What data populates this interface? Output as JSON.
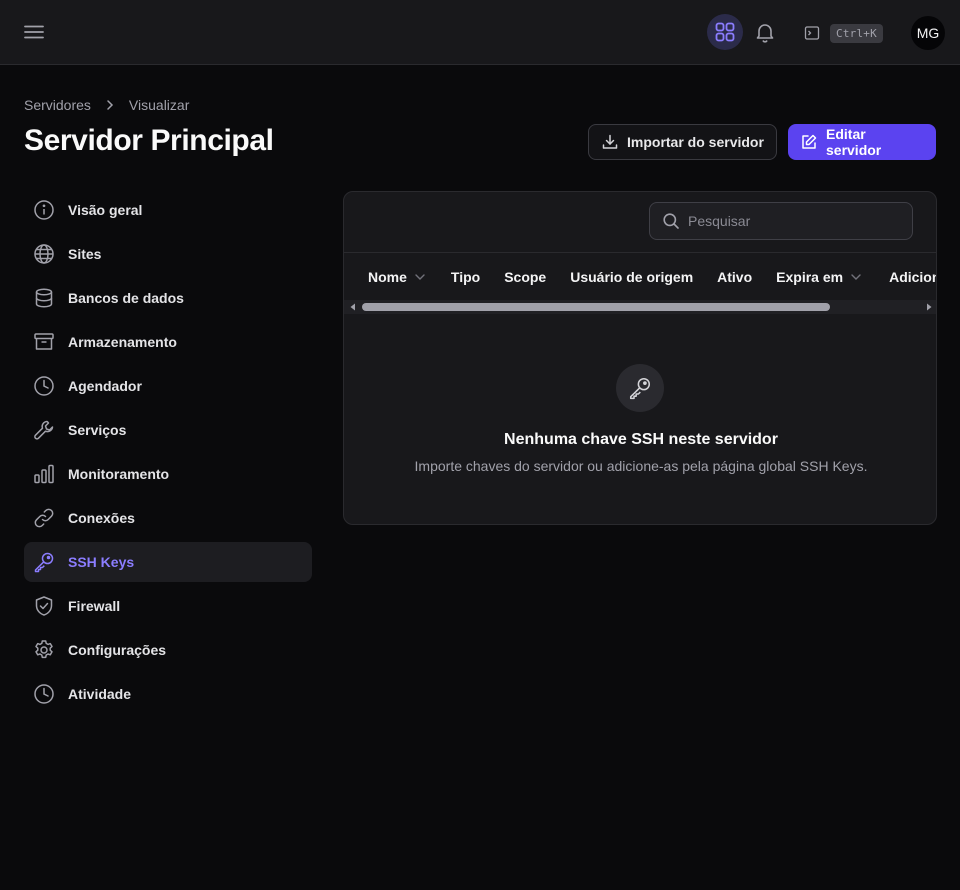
{
  "topbar": {
    "shortcut": "Ctrl+K",
    "avatar_initials": "MG"
  },
  "breadcrumb": [
    {
      "label": "Servidores"
    },
    {
      "label": "Visualizar"
    }
  ],
  "page": {
    "title": "Servidor Principal",
    "import_label": "Importar do servidor",
    "edit_label": "Editar servidor"
  },
  "sidebar": {
    "items": [
      {
        "label": "Visão geral",
        "icon": "info-icon"
      },
      {
        "label": "Sites",
        "icon": "globe-icon"
      },
      {
        "label": "Bancos de dados",
        "icon": "database-icon"
      },
      {
        "label": "Armazenamento",
        "icon": "archive-icon"
      },
      {
        "label": "Agendador",
        "icon": "clock-icon"
      },
      {
        "label": "Serviços",
        "icon": "wrench-icon"
      },
      {
        "label": "Monitoramento",
        "icon": "bar-chart-icon"
      },
      {
        "label": "Conexões",
        "icon": "link-icon"
      },
      {
        "label": "SSH Keys",
        "icon": "key-icon",
        "active": true
      },
      {
        "label": "Firewall",
        "icon": "shield-check-icon"
      },
      {
        "label": "Configurações",
        "icon": "gear-icon"
      },
      {
        "label": "Atividade",
        "icon": "clock-icon"
      }
    ]
  },
  "table": {
    "search_placeholder": "Pesquisar",
    "columns": [
      {
        "label": "Nome",
        "sortable": true
      },
      {
        "label": "Tipo"
      },
      {
        "label": "Scope"
      },
      {
        "label": "Usuário de origem"
      },
      {
        "label": "Ativo"
      },
      {
        "label": "Expira em",
        "sortable": true
      },
      {
        "label": "Adicionado em"
      }
    ],
    "rows": []
  },
  "empty_state": {
    "icon": "key-icon",
    "title": "Nenhuma chave SSH neste servidor",
    "description": "Importe chaves do servidor ou adicione-as pela página global SSH Keys."
  },
  "colors": {
    "accent": "#5b43f0",
    "active_nav_text": "#8b7dff",
    "background": "#0a0a0c",
    "surface": "#18181b"
  }
}
